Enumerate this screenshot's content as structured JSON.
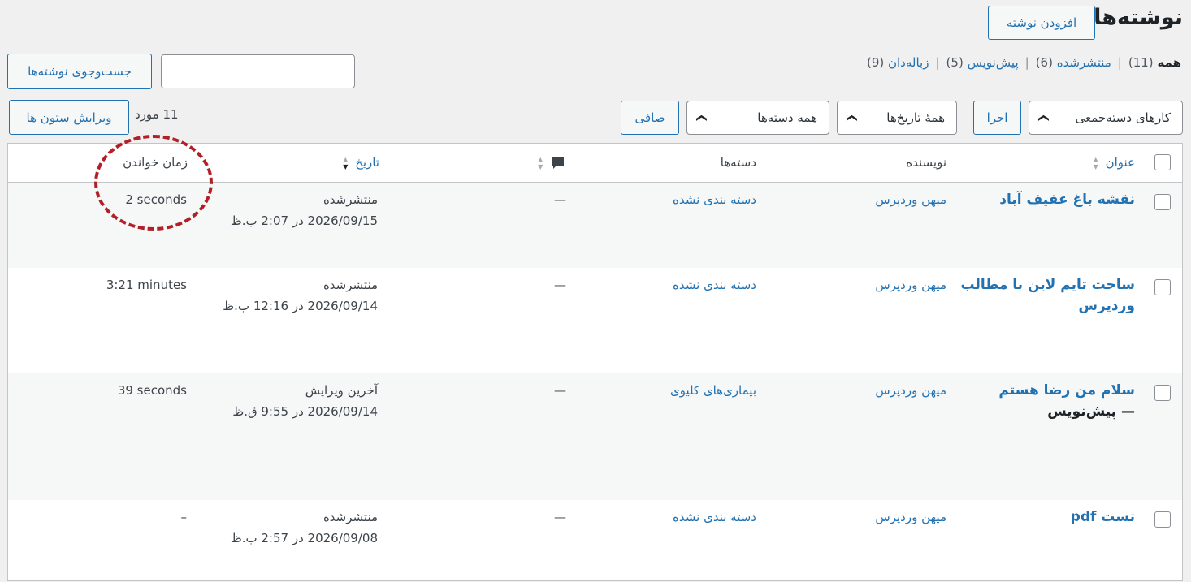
{
  "page": {
    "title": "نوشته‌ها",
    "add_new_label": "افزودن نوشته"
  },
  "views": [
    {
      "label": "همه",
      "count": "(11)"
    },
    {
      "label": "منتشرشده",
      "count": "(6)"
    },
    {
      "label": "پیش‌نویس",
      "count": "(5)"
    },
    {
      "label": "زباله‌دان",
      "count": "(9)"
    }
  ],
  "search": {
    "placeholder": "",
    "button_label": "جست‌وجوی نوشته‌ها"
  },
  "filters": {
    "bulk_actions": "کارهای دسته‌جمعی",
    "apply_label": "اجرا",
    "dates": "همهٔ تاریخ‌ها",
    "categories": "همه دسته‌ها",
    "filter_label": "صافی"
  },
  "items_count": "11 مورد",
  "columns_button": "ویرایش ستون ها",
  "columns": {
    "title": "عنوان",
    "author": "نویسنده",
    "categories": "دسته‌ها",
    "date": "تاریخ",
    "reading_time": "زمان خواندن"
  },
  "icons": {
    "comments": "comment-bubble-icon",
    "dropdown": "chevron-down-icon"
  },
  "colors": {
    "link": "#2271b1",
    "annotation": "#b22027"
  },
  "rows": [
    {
      "title": "نقشه باغ عفیف آباد",
      "title_line2": "",
      "state": "",
      "author": "میهن وردپرس",
      "category": "دسته بندی نشده",
      "comments": "—",
      "status": "منتشرشده",
      "date": "2026/09/15 در 2:07 ب.ظ",
      "reading_time": "2 seconds"
    },
    {
      "title": "ساخت تایم لاین با مطالب",
      "title_line2": "وردپرس",
      "state": "",
      "author": "میهن وردپرس",
      "category": "دسته بندی نشده",
      "comments": "—",
      "status": "منتشرشده",
      "date": "2026/09/14 در 12:16 ب.ظ",
      "reading_time": "3:21 minutes"
    },
    {
      "title": "سلام من رضا هستم",
      "title_line2": "",
      "state": "— پیش‌نویس",
      "author": "میهن وردپرس",
      "category": "بیماری‌های کلیوی",
      "comments": "—",
      "status": "آخرین ویرایش",
      "date": "2026/09/14 در 9:55 ق.ظ",
      "reading_time": "39 seconds"
    },
    {
      "title": "تست pdf",
      "title_line2": "",
      "state": "",
      "author": "میهن وردپرس",
      "category": "دسته بندی نشده",
      "comments": "—",
      "status": "منتشرشده",
      "date": "2026/09/08 در 2:57 ب.ظ",
      "reading_time": "–"
    }
  ]
}
